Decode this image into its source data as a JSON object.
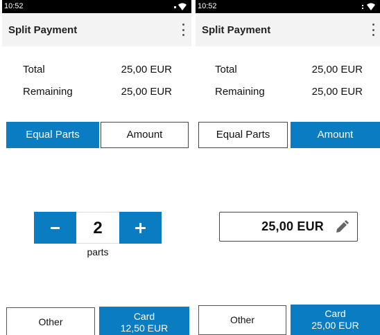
{
  "screens": [
    {
      "status_time": "10:52",
      "title": "Split Payment",
      "total_label": "Total",
      "total_value": "25,00 EUR",
      "remaining_label": "Remaining",
      "remaining_value": "25,00 EUR",
      "tab_equal": "Equal Parts",
      "tab_amount": "Amount",
      "active_tab": "Equal Parts",
      "stepper": {
        "minus": "−",
        "value": "2",
        "plus": "+",
        "unit": "parts"
      },
      "other_label": "Other",
      "card_label": "Card",
      "card_amount": "12,50 EUR"
    },
    {
      "status_time": "10:52",
      "title": "Split Payment",
      "total_label": "Total",
      "total_value": "25,00 EUR",
      "remaining_label": "Remaining",
      "remaining_value": "25,00 EUR",
      "tab_equal": "Equal Parts",
      "tab_amount": "Amount",
      "active_tab": "Amount",
      "amount_value": "25,00 EUR",
      "other_label": "Other",
      "card_label": "Card",
      "card_amount": "25,00 EUR"
    }
  ],
  "colors": {
    "accent": "#0a7cc2",
    "appbar": "#f3f3f3",
    "statusbar": "#000000"
  },
  "icons": {
    "status": [
      "signal-icon",
      "wifi-icon"
    ],
    "menu": "more-vert-icon",
    "edit": "pencil-icon"
  }
}
